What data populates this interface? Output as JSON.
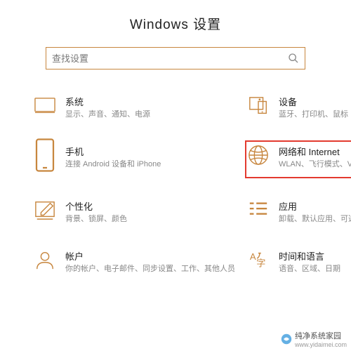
{
  "title": "Windows 设置",
  "search": {
    "placeholder": "查找设置"
  },
  "tiles": {
    "system": {
      "title": "系统",
      "desc": "显示、声音、通知、电源"
    },
    "devices": {
      "title": "设备",
      "desc": "蓝牙、打印机、鼠标"
    },
    "phone": {
      "title": "手机",
      "desc": "连接 Android 设备和 iPhone"
    },
    "network": {
      "title": "网络和 Internet",
      "desc": "WLAN、飞行模式、VPN"
    },
    "personal": {
      "title": "个性化",
      "desc": "背景、锁屏、颜色"
    },
    "apps": {
      "title": "应用",
      "desc": "卸载、默认应用、可选功能"
    },
    "accounts": {
      "title": "帐户",
      "desc": "你的帐户、电子邮件、同步设置、工作、其他人员"
    },
    "time": {
      "title": "时间和语言",
      "desc": "语音、区域、日期"
    }
  },
  "watermark": {
    "name": "纯净系统家园",
    "url": "www.yidaimei.com"
  }
}
